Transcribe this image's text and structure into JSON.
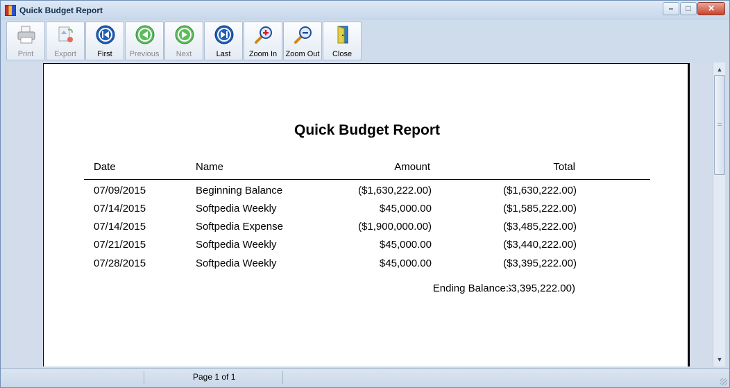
{
  "window": {
    "title": "Quick Budget Report",
    "icon": "app-icon",
    "controls": {
      "minimize": "minimize-icon",
      "maximize": "maximize-icon",
      "close": "close-icon"
    }
  },
  "toolbar": {
    "buttons": [
      {
        "label": "Print",
        "icon": "printer-icon",
        "enabled": false
      },
      {
        "label": "Export",
        "icon": "export-icon",
        "enabled": false
      },
      {
        "label": "First",
        "icon": "first-page-icon",
        "enabled": true
      },
      {
        "label": "Previous",
        "icon": "previous-page-icon",
        "enabled": false
      },
      {
        "label": "Next",
        "icon": "next-page-icon",
        "enabled": false
      },
      {
        "label": "Last",
        "icon": "last-page-icon",
        "enabled": true
      },
      {
        "label": "Zoom In",
        "icon": "zoom-in-icon",
        "enabled": true
      },
      {
        "label": "Zoom Out",
        "icon": "zoom-out-icon",
        "enabled": true
      },
      {
        "label": "Close",
        "icon": "door-icon",
        "enabled": true
      }
    ]
  },
  "report": {
    "title": "Quick Budget Report",
    "columns": {
      "date": "Date",
      "name": "Name",
      "amount": "Amount",
      "total": "Total"
    },
    "rows": [
      {
        "date": "07/09/2015",
        "name": "Beginning Balance",
        "amount": "($1,630,222.00)",
        "total": "($1,630,222.00)"
      },
      {
        "date": "07/14/2015",
        "name": "Softpedia Weekly",
        "amount": "$45,000.00",
        "total": "($1,585,222.00)"
      },
      {
        "date": "07/14/2015",
        "name": "Softpedia Expense",
        "amount": "($1,900,000.00)",
        "total": "($3,485,222.00)"
      },
      {
        "date": "07/21/2015",
        "name": "Softpedia Weekly",
        "amount": "$45,000.00",
        "total": "($3,440,222.00)"
      },
      {
        "date": "07/28/2015",
        "name": "Softpedia Weekly",
        "amount": "$45,000.00",
        "total": "($3,395,222.00)"
      }
    ],
    "ending_label": "Ending Balance:",
    "ending_value": "($3,395,222.00)"
  },
  "status": {
    "page": "Page 1 of 1"
  },
  "colors": {
    "accent": "#1f5fb8",
    "green": "#3aa83a",
    "frame": "#cfdcec"
  }
}
